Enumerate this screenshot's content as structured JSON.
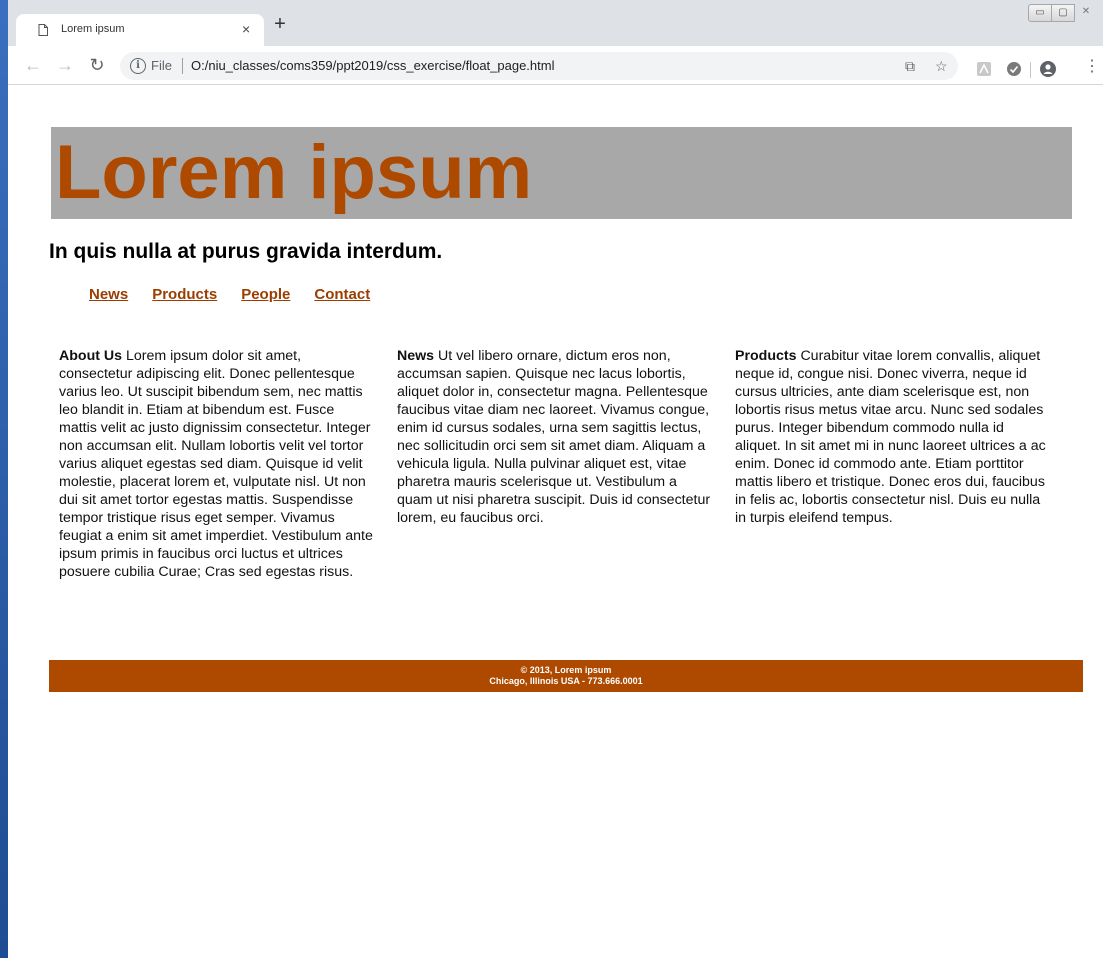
{
  "browser": {
    "tab_title": "Lorem ipsum",
    "tab_close": "×",
    "new_tab": "+",
    "file_label": "File",
    "url": "O:/niu_classes/coms359/ppt2019/css_exercise/float_page.html",
    "window_controls": [
      "▭",
      "▢",
      "✕"
    ]
  },
  "page": {
    "title": "Lorem ipsum",
    "subtitle": "In quis nulla at purus gravida interdum.",
    "nav": [
      "News",
      "Products",
      "People",
      "Contact"
    ],
    "columns": [
      {
        "heading": "About Us",
        "body": "Lorem ipsum dolor sit amet, consectetur adipiscing elit. Donec pellentesque varius leo. Ut suscipit bibendum sem, nec mattis leo blandit in. Etiam at bibendum est. Fusce mattis velit ac justo dignissim consectetur. Integer non accumsan elit. Nullam lobortis velit vel tortor varius aliquet egestas sed diam. Quisque id velit molestie, placerat lorem et, vulputate nisl. Ut non dui sit amet tortor egestas mattis. Suspendisse tempor tristique risus eget semper. Vivamus feugiat a enim sit amet imperdiet. Vestibulum ante ipsum primis in faucibus orci luctus et ultrices posuere cubilia Curae; Cras sed egestas risus."
      },
      {
        "heading": "News",
        "body": "Ut vel libero ornare, dictum eros non, accumsan sapien. Quisque nec lacus lobortis, aliquet dolor in, consectetur magna. Pellentesque faucibus vitae diam nec laoreet. Vivamus congue, enim id cursus sodales, urna sem sagittis lectus, nec sollicitudin orci sem sit amet diam. Aliquam a vehicula ligula. Nulla pulvinar aliquet est, vitae pharetra mauris scelerisque ut. Vestibulum a quam ut nisi pharetra suscipit. Duis id consectetur lorem, eu faucibus orci."
      },
      {
        "heading": "Products",
        "body": "Curabitur vitae lorem convallis, aliquet neque id, congue nisi. Donec viverra, neque id cursus ultricies, ante diam scelerisque est, non lobortis risus metus vitae arcu. Nunc sed sodales purus. Integer bibendum commodo nulla id aliquet. In sit amet mi in nunc laoreet ultrices a ac enim. Donec id commodo ante. Etiam porttitor mattis libero et tristique. Donec eros dui, faucibus in felis ac, lobortis consectetur nisl. Duis eu nulla in turpis eleifend tempus."
      }
    ],
    "footer_line1": "© 2013, Lorem ipsum",
    "footer_line2": "Chicago, Illinois USA - 773.666.0001"
  },
  "colors": {
    "accent": "#ad4a00",
    "banner_bg": "#a8a8a8",
    "link": "#9b3d00"
  }
}
